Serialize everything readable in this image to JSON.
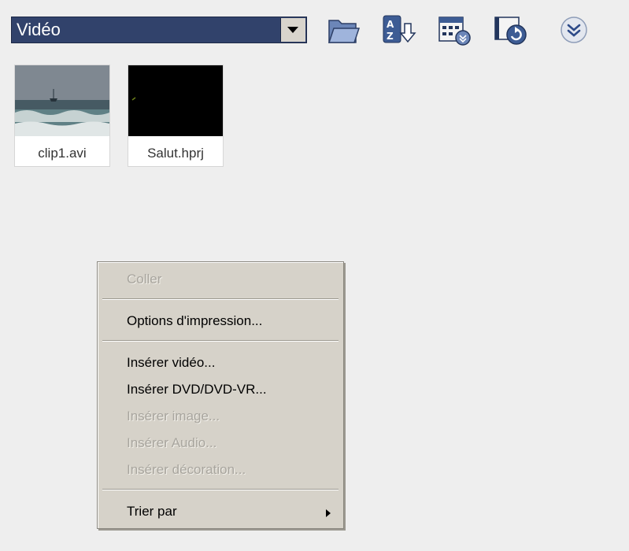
{
  "toolbar": {
    "media_type_value": "Vidéo",
    "icons": [
      "dropdown-arrow-icon",
      "folder-icon",
      "sort-az-icon",
      "view-options-icon",
      "media-refresh-icon",
      "more-chevron-icon"
    ]
  },
  "clips": [
    {
      "label": "clip1.avi"
    },
    {
      "label": "Salut.hprj"
    }
  ],
  "context_menu": {
    "items": [
      {
        "label": "Coller",
        "enabled": false
      },
      {
        "label": "Options d'impression...",
        "enabled": true
      },
      {
        "label": "Insérer vidéo...",
        "enabled": true
      },
      {
        "label": "Insérer DVD/DVD-VR...",
        "enabled": true
      },
      {
        "label": "Insérer image...",
        "enabled": false
      },
      {
        "label": "Insérer Audio...",
        "enabled": false
      },
      {
        "label": "Insérer décoration...",
        "enabled": false
      },
      {
        "label": "Trier par",
        "enabled": true,
        "submenu": true
      }
    ]
  },
  "colors": {
    "combo_bg": "#31426b",
    "menu_bg": "#d6d2c9",
    "window_bg": "#eeeeee"
  }
}
